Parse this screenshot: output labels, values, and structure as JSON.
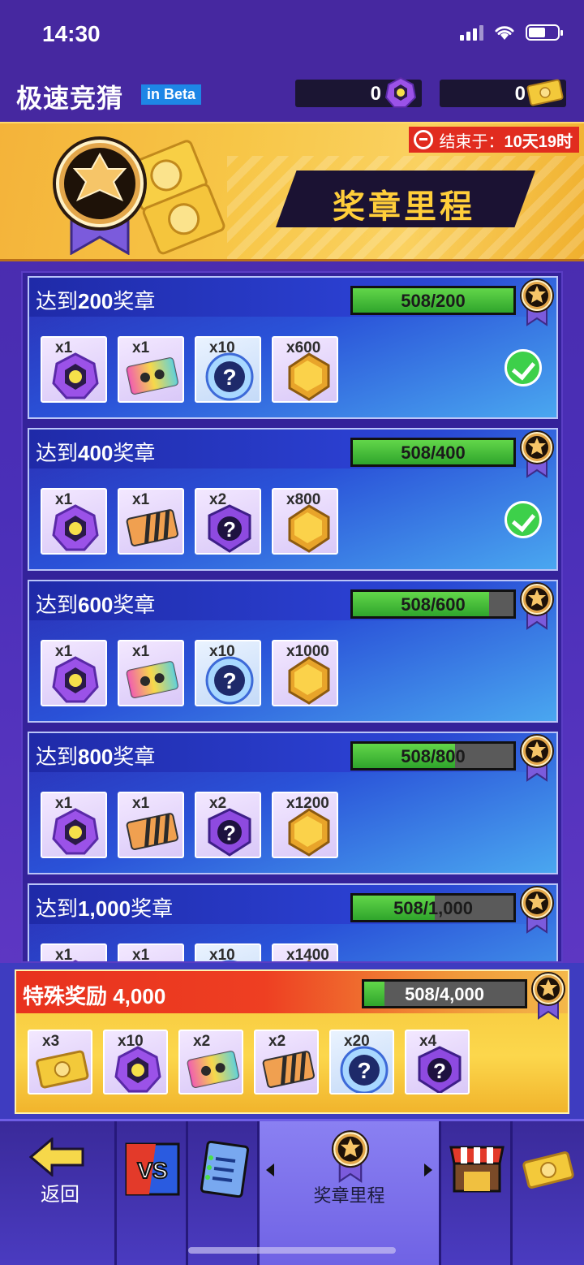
{
  "status": {
    "time": "14:30"
  },
  "app": {
    "title": "极速竞猜",
    "beta": "in Beta",
    "gem_count": "0",
    "ticket_count": "0"
  },
  "banner": {
    "end_label": "结束于：",
    "end_time": "10天19时",
    "ribbon": "奖章里程"
  },
  "milestones": [
    {
      "label_prefix": "达到",
      "label_num": "200",
      "label_suffix": "奖章",
      "progress_text": "508/200",
      "progress": 1.0,
      "done": true,
      "rewards": [
        {
          "qty": "x1",
          "icon": "gem-icon"
        },
        {
          "qty": "x1",
          "icon": "rainbow-ticket-icon"
        },
        {
          "qty": "x10",
          "icon": "mystery-orb-icon"
        },
        {
          "qty": "x600",
          "icon": "gold-hexagon-icon"
        }
      ]
    },
    {
      "label_prefix": "达到",
      "label_num": "400",
      "label_suffix": "奖章",
      "progress_text": "508/400",
      "progress": 1.0,
      "done": true,
      "rewards": [
        {
          "qty": "x1",
          "icon": "gem-icon"
        },
        {
          "qty": "x1",
          "icon": "striped-ticket-icon"
        },
        {
          "qty": "x2",
          "icon": "mystery-box-icon"
        },
        {
          "qty": "x800",
          "icon": "gold-hexagon-icon"
        }
      ]
    },
    {
      "label_prefix": "达到",
      "label_num": "600",
      "label_suffix": "奖章",
      "progress_text": "508/600",
      "progress": 0.847,
      "done": false,
      "rewards": [
        {
          "qty": "x1",
          "icon": "gem-icon"
        },
        {
          "qty": "x1",
          "icon": "rainbow-ticket-icon"
        },
        {
          "qty": "x10",
          "icon": "mystery-orb-icon"
        },
        {
          "qty": "x1000",
          "icon": "gold-hexagon-icon"
        }
      ]
    },
    {
      "label_prefix": "达到",
      "label_num": "800",
      "label_suffix": "奖章",
      "progress_text": "508/800",
      "progress": 0.635,
      "done": false,
      "rewards": [
        {
          "qty": "x1",
          "icon": "gem-icon"
        },
        {
          "qty": "x1",
          "icon": "striped-ticket-icon"
        },
        {
          "qty": "x2",
          "icon": "mystery-box-icon"
        },
        {
          "qty": "x1200",
          "icon": "gold-hexagon-icon"
        }
      ]
    },
    {
      "label_prefix": "达到",
      "label_num": "1,000",
      "label_suffix": "奖章",
      "progress_text": "508/1,000",
      "progress": 0.508,
      "done": false,
      "rewards": [
        {
          "qty": "x1",
          "icon": "gem-icon"
        },
        {
          "qty": "x1",
          "icon": "striped-ticket-icon"
        },
        {
          "qty": "x10",
          "icon": "mystery-orb-icon"
        },
        {
          "qty": "x1400",
          "icon": "gold-hexagon-icon"
        }
      ]
    }
  ],
  "special": {
    "label": "特殊奖励 4,000",
    "progress_text": "508/4,000",
    "progress": 0.127,
    "rewards": [
      {
        "qty": "x3",
        "icon": "gold-ticket-icon"
      },
      {
        "qty": "x10",
        "icon": "gem-icon"
      },
      {
        "qty": "x2",
        "icon": "rainbow-ticket-icon"
      },
      {
        "qty": "x2",
        "icon": "striped-ticket-icon"
      },
      {
        "qty": "x20",
        "icon": "mystery-orb-icon"
      },
      {
        "qty": "x4",
        "icon": "mystery-box-icon"
      }
    ]
  },
  "nav": {
    "back": "返回",
    "active": "奖章里程"
  }
}
